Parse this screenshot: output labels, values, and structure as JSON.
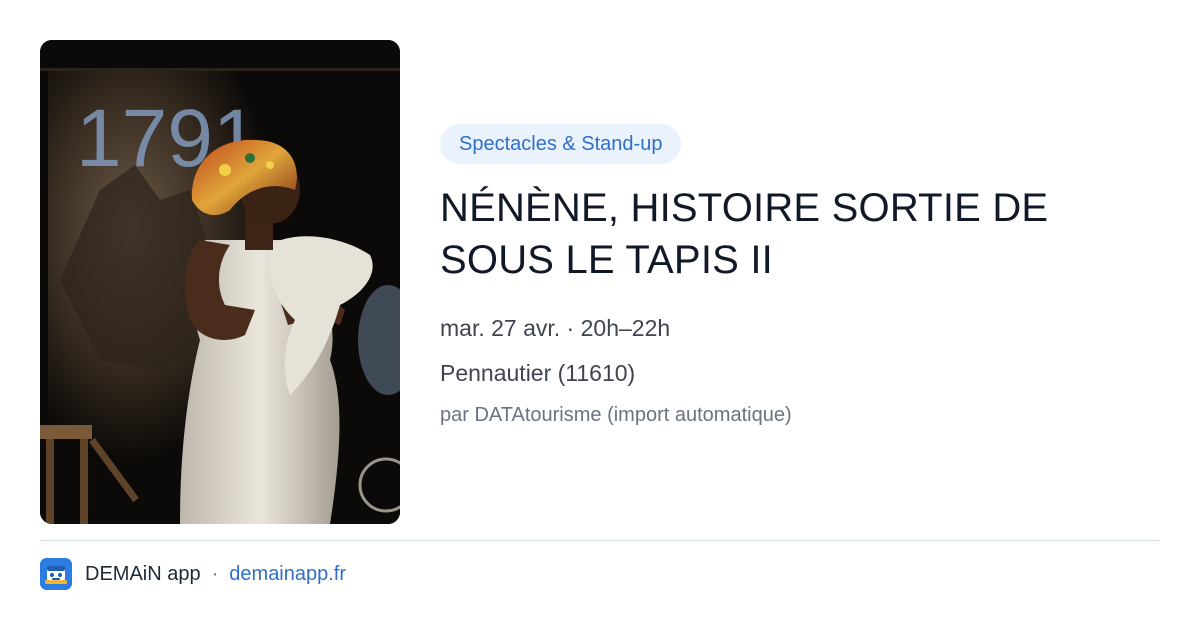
{
  "event": {
    "category": "Spectacles & Stand-up",
    "title": "NÉNÈNE, HISTOIRE SORTIE DE SOUS LE TAPIS II",
    "datetime": "mar. 27 avr. · 20h–22h",
    "location": "Pennautier (11610)",
    "source": "par DATAtourisme (import automatique)",
    "image": {
      "backdrop_text": "1791",
      "icon": "performer-photo"
    }
  },
  "footer": {
    "app_name": "DEMAiN app",
    "separator": "·",
    "url": "demainapp.fr",
    "logo_icon": "demain-logo-icon"
  },
  "colors": {
    "accent": "#2f6fc9",
    "chip_background": "#eaf2fd",
    "logo_background": "#2b7de1"
  }
}
